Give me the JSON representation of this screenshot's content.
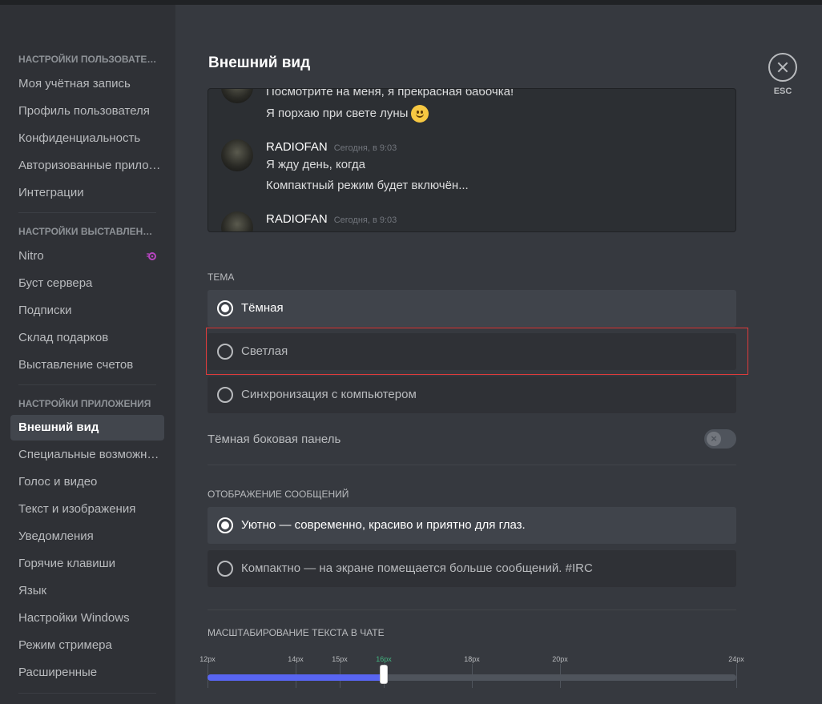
{
  "sidebar": {
    "sections": [
      {
        "header": "НАСТРОЙКИ ПОЛЬЗОВАТЕЛЯ",
        "items": [
          "Моя учётная запись",
          "Профиль пользователя",
          "Конфиденциальность",
          "Авторизованные приложения",
          "Интеграции"
        ]
      },
      {
        "header": "НАСТРОЙКИ ВЫСТАВЛЕНИЯ СЧЕТОВ",
        "items": [
          "Nitro",
          "Буст сервера",
          "Подписки",
          "Склад подарков",
          "Выставление счетов"
        ]
      },
      {
        "header": "НАСТРОЙКИ ПРИЛОЖЕНИЯ",
        "items": [
          "Внешний вид",
          "Специальные возможности",
          "Голос и видео",
          "Текст и изображения",
          "Уведомления",
          "Горячие клавиши",
          "Язык",
          "Настройки Windows",
          "Режим стримера",
          "Расширенные"
        ]
      }
    ],
    "active_item": "Внешний вид"
  },
  "page": {
    "title": "Внешний вид"
  },
  "preview": {
    "messages": [
      {
        "text": "Посмотрите на меня, я прекрасная бабочка!"
      },
      {
        "text": "Я порхаю при свете луны"
      },
      {
        "author": "RADIOFAN",
        "timestamp": "Сегодня, в 9:03",
        "text": "Я жду день, когда"
      },
      {
        "text": "Компактный режим будет включён..."
      },
      {
        "author": "RADIOFAN",
        "timestamp": "Сегодня, в 9:03"
      }
    ]
  },
  "theme": {
    "label": "ТЕМА",
    "options": [
      "Тёмная",
      "Светлая",
      "Синхронизация с компьютером"
    ],
    "selected": "Тёмная"
  },
  "dark_sidebar": {
    "label": "Тёмная боковая панель",
    "enabled": false
  },
  "message_display": {
    "label": "ОТОБРАЖЕНИЕ СООБЩЕНИЙ",
    "options": [
      "Уютно — современно, красиво и приятно для глаз.",
      "Компактно — на экране помещается больше сообщений. #IRC"
    ],
    "selected": "Уютно — современно, красиво и приятно для глаз."
  },
  "text_scaling": {
    "label": "МАСШТАБИРОВАНИЕ ТЕКСТА В ЧАТЕ",
    "ticks": [
      "12px",
      "14px",
      "15px",
      "16px",
      "18px",
      "20px",
      "24px"
    ],
    "tick_values": [
      12,
      14,
      15,
      16,
      18,
      20,
      24
    ],
    "min": 12,
    "max": 24,
    "value": 16
  },
  "close": {
    "label": "ESC"
  },
  "colors": {
    "accent": "#5865f2",
    "active_tick": "#43b581",
    "nitro": "#b845c1",
    "highlight": "#e03b3b"
  }
}
